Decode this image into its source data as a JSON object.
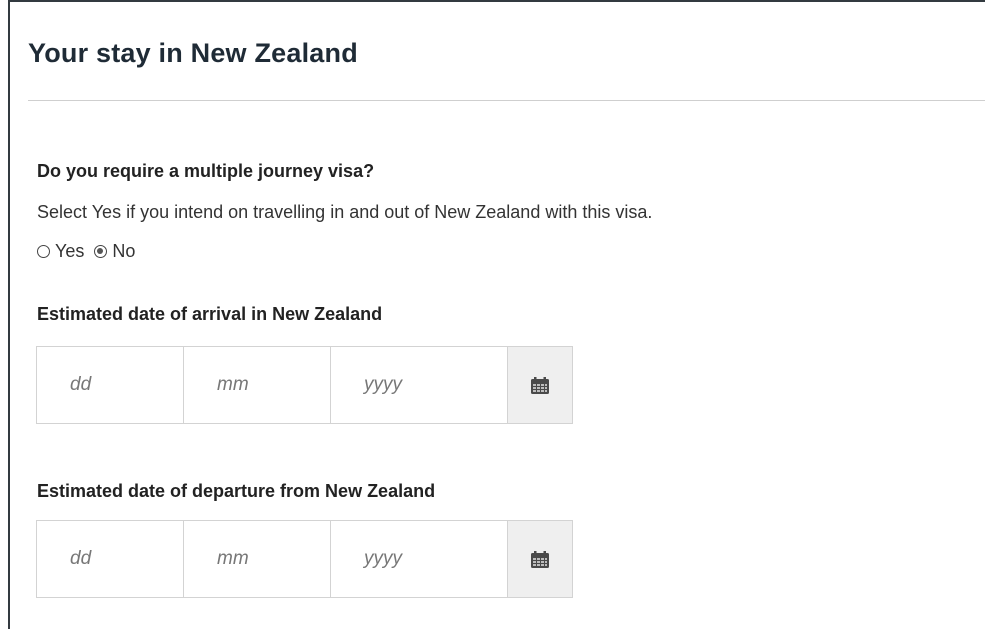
{
  "section": {
    "title": "Your stay in New Zealand"
  },
  "multiple_journey": {
    "question": "Do you require a multiple journey visa?",
    "help": "Select Yes if you intend on travelling in and out of New Zealand with this visa.",
    "options": [
      {
        "label": "Yes",
        "checked": false
      },
      {
        "label": "No",
        "checked": true
      }
    ]
  },
  "arrival": {
    "label": "Estimated date of arrival in New Zealand",
    "day_placeholder": "dd",
    "month_placeholder": "mm",
    "year_placeholder": "yyyy",
    "calendar_icon": "calendar-icon"
  },
  "departure": {
    "label": "Estimated date of departure from New Zealand",
    "day_placeholder": "dd",
    "month_placeholder": "mm",
    "year_placeholder": "yyyy",
    "calendar_icon": "calendar-icon"
  }
}
